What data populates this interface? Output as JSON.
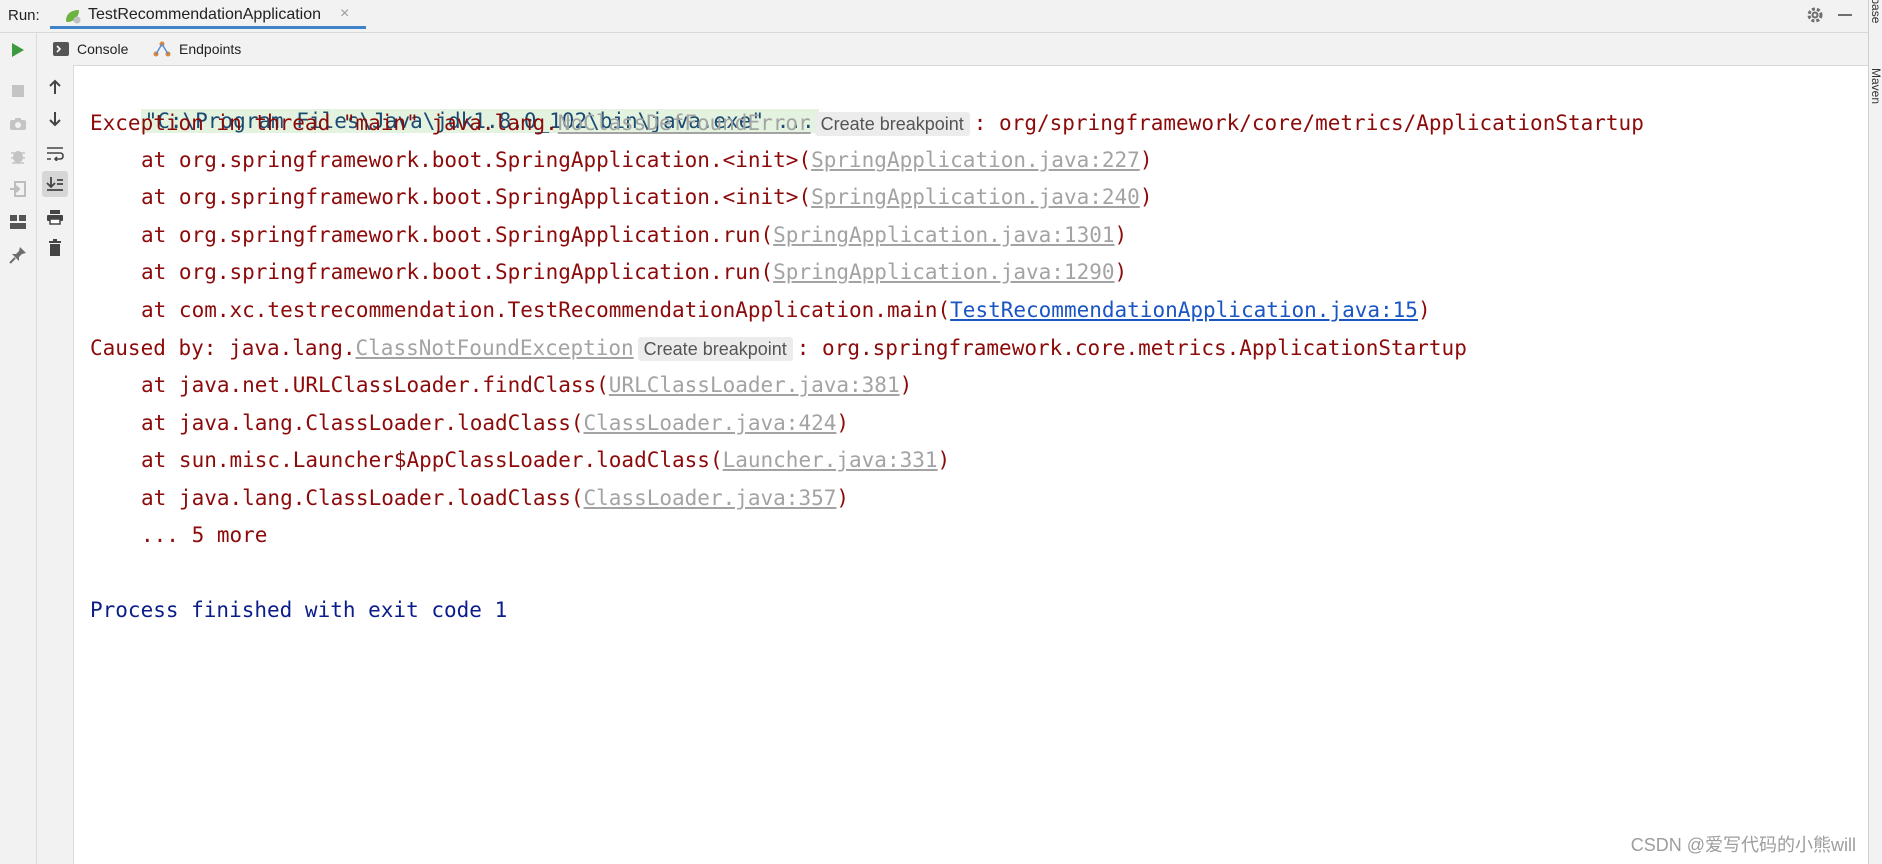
{
  "run_bar": {
    "label": "Run:",
    "tab_title": "TestRecommendationApplication",
    "close_glyph": "×",
    "settings_icon": "gear-icon",
    "minimize_icon": "minimize-icon"
  },
  "right_strip": {
    "database_label": "Database",
    "maven_label": "Maven"
  },
  "tabs": {
    "console_label": "Console",
    "endpoints_label": "Endpoints"
  },
  "console": {
    "command": "\"C:\\Program Files\\Java\\jdk1.8.0_102\\bin\\java.exe\" ...",
    "exception_prefix": "Exception in thread \"main\" java.lang.",
    "exception_class": "NoClassDefFoundError",
    "breakpoint_label": "Create breakpoint",
    "exception_suffix": ": org/springframework/core/metrics/ApplicationStartup",
    "trace1": [
      {
        "prefix": "at org.springframework.boot.SpringApplication.<init>(",
        "link": "SpringApplication.java:227",
        "suffix": ")"
      },
      {
        "prefix": "at org.springframework.boot.SpringApplication.<init>(",
        "link": "SpringApplication.java:240",
        "suffix": ")"
      },
      {
        "prefix": "at org.springframework.boot.SpringApplication.run(",
        "link": "SpringApplication.java:1301",
        "suffix": ")"
      },
      {
        "prefix": "at org.springframework.boot.SpringApplication.run(",
        "link": "SpringApplication.java:1290",
        "suffix": ")"
      },
      {
        "prefix": "at com.xc.testrecommendation.TestRecommendationApplication.main(",
        "link": "TestRecommendationApplication.java:15",
        "suffix": ")"
      }
    ],
    "caused_prefix": "Caused by: java.lang.",
    "caused_class": "ClassNotFoundException",
    "caused_suffix": ": org.springframework.core.metrics.ApplicationStartup",
    "trace2": [
      {
        "prefix": "at java.net.URLClassLoader.findClass(",
        "link": "URLClassLoader.java:381",
        "suffix": ")"
      },
      {
        "prefix": "at java.lang.ClassLoader.loadClass(",
        "link": "ClassLoader.java:424",
        "suffix": ")"
      },
      {
        "prefix": "at sun.misc.Launcher$AppClassLoader.loadClass(",
        "link": "Launcher.java:331",
        "suffix": ")"
      },
      {
        "prefix": "at java.lang.ClassLoader.loadClass(",
        "link": "ClassLoader.java:357",
        "suffix": ")"
      }
    ],
    "more": "... 5 more",
    "finished": "Process finished with exit code 1"
  },
  "watermark": "CSDN @爱写代码的小熊will",
  "colors": {
    "error_text": "#8c0a0a",
    "link_gray": "#a3a3a3",
    "link_blue": "#1a55c4",
    "finished_text": "#0b1d8a",
    "command_bg": "#e3f3df",
    "tab_underline": "#4083c9",
    "run_green": "#3d9a3d"
  }
}
